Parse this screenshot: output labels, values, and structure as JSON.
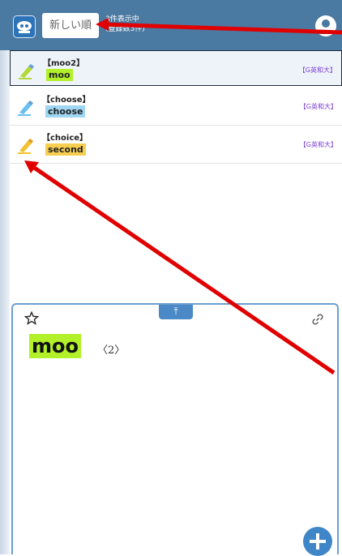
{
  "header": {
    "sort_label": "新しい順",
    "count_line1": "3件表示中",
    "count_line2": "(登録数3件)"
  },
  "list": [
    {
      "head": "【moo2】",
      "word": "moo",
      "dict": "【G英和大】",
      "highlight": "#b2f02a",
      "pen": "#b2d83a",
      "selected": true
    },
    {
      "head": "【choose】",
      "word": "choose",
      "dict": "【G英和大】",
      "highlight": "#9fd6f2",
      "pen": "#69c0f0",
      "selected": false
    },
    {
      "head": "【choice】",
      "word": "choice",
      "display": "second",
      "dict": "【G英和大】",
      "highlight": "#f7cf50",
      "pen": "#f1c232",
      "selected": false
    }
  ],
  "detail": {
    "collapse_icon": "⤒",
    "word": "moo",
    "number": "〈2〉"
  },
  "colors": {
    "header_bg": "#4a79a2",
    "panel_border": "#6aa0cf",
    "accent_blue": "#3f86c8",
    "annotation_red": "#e00000"
  }
}
